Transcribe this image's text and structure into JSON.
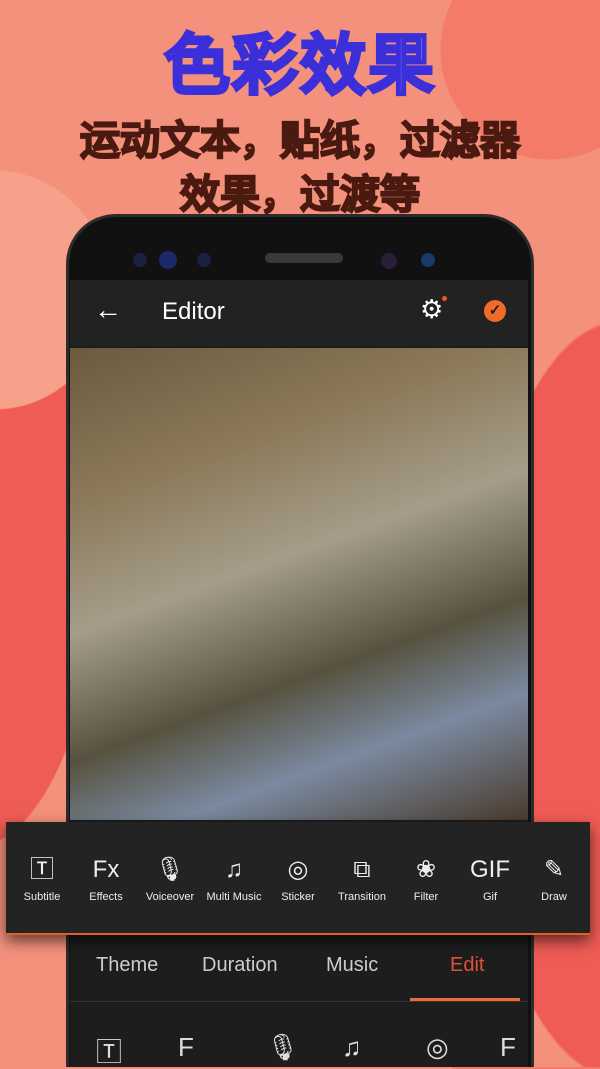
{
  "promo": {
    "headline": "色彩效果",
    "subline1": "运动文本，贴纸，过滤器",
    "subline2": "效果，过渡等"
  },
  "appbar": {
    "back_icon": "arrow-left-icon",
    "title": "Editor",
    "settings_icon": "gear-icon",
    "confirm_icon": "check-circle-icon"
  },
  "tools": [
    {
      "label": "Subtitle",
      "icon": "text-box-icon",
      "glyph": "🅃"
    },
    {
      "label": "Effects",
      "icon": "fx-icon",
      "glyph": "Fx"
    },
    {
      "label": "Voiceover",
      "icon": "microphone-icon",
      "glyph": "🎙"
    },
    {
      "label": "Multi Music",
      "icon": "music-stack-icon",
      "glyph": "♫"
    },
    {
      "label": "Sticker",
      "icon": "sticker-icon",
      "glyph": "◎"
    },
    {
      "label": "Transition",
      "icon": "overlap-squares-icon",
      "glyph": "⧉"
    },
    {
      "label": "Filter",
      "icon": "filter-circles-icon",
      "glyph": "❀"
    },
    {
      "label": "Gif",
      "icon": "gif-icon",
      "glyph": "GIF"
    },
    {
      "label": "Draw",
      "icon": "brush-icon",
      "glyph": "✎"
    }
  ],
  "tabs": [
    {
      "label": "Theme"
    },
    {
      "label": "Duration"
    },
    {
      "label": "Music"
    },
    {
      "label": "Edit",
      "active": true
    }
  ],
  "colors": {
    "accent": "#ec6a3c",
    "background": "#f4917c",
    "toolbar": "#232323"
  }
}
